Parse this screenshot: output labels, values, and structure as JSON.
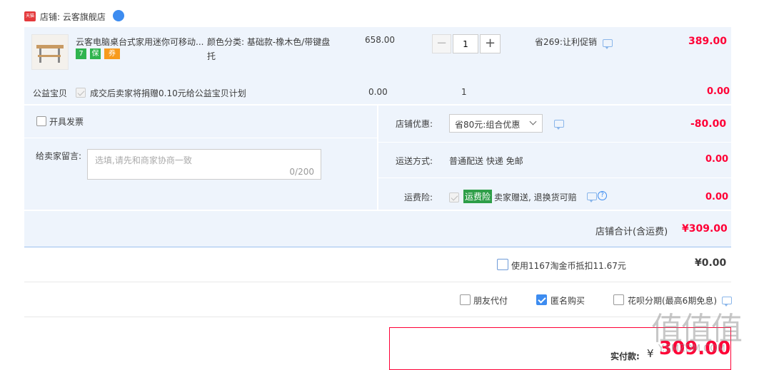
{
  "shop": {
    "badge": "天猫",
    "name": "店铺: 云客旗舰店"
  },
  "item": {
    "title": "云客电脑桌台式家用迷你可移动...",
    "sku_line1": "颜色分类: 基础款-橡木色/带键盘",
    "sku_line2": "托",
    "price": "658.00",
    "qty": "1",
    "promo": "省269:让利促销",
    "subtotal": "389.00",
    "tags": [
      "7",
      "保",
      "券"
    ]
  },
  "charity": {
    "label": "公益宝贝",
    "desc": "成交后卖家将捐赠0.10元给公益宝贝计划",
    "price": "0.00",
    "qty": "1",
    "subtotal": "0.00"
  },
  "invoice": {
    "label": "开具发票"
  },
  "message": {
    "label": "给卖家留言:",
    "placeholder": "选填,请先和商家协商一致",
    "count": "0/200"
  },
  "discount": {
    "label": "店铺优惠:",
    "selected": "省80元:组合优惠",
    "amount": "-80.00"
  },
  "shipping": {
    "label": "运送方式:",
    "value": "普通配送 快递 免邮",
    "amount": "0.00"
  },
  "insurance": {
    "label": "运费险:",
    "badge": "运费险",
    "desc": "卖家赠送, 退换货可赔",
    "amount": "0.00"
  },
  "shop_total": {
    "label": "店铺合计(含运费)",
    "amount": "¥309.00"
  },
  "coins": {
    "label": "使用1167淘金币抵扣11.67元",
    "amount": "¥0.00"
  },
  "options": [
    {
      "label": "朋友代付",
      "checked": false
    },
    {
      "label": "匿名购买",
      "checked": true
    },
    {
      "label": "花呗分期(最高6期免息)",
      "checked": false
    }
  ],
  "pay": {
    "label": "实付款:",
    "currency": "¥",
    "amount": "309.00"
  },
  "watermark": {
    "text": "值值值",
    "site": "Y.SMZDM.COM"
  },
  "colors": {
    "accent": "#ff0036",
    "blue_bg": "#eef4fc",
    "link_blue": "#3d8cf0"
  }
}
